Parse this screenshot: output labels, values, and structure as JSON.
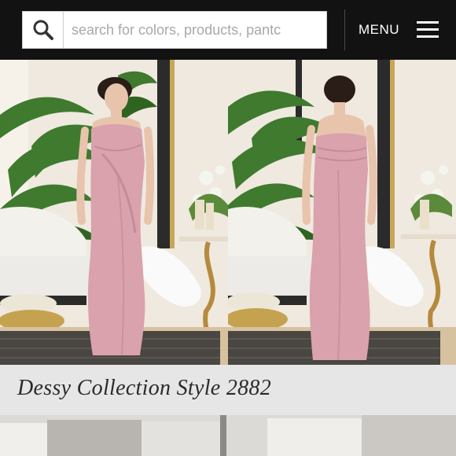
{
  "header": {
    "search": {
      "placeholder": "search for colors, products, pantc",
      "icon": "search-icon"
    },
    "menu_label": "MENU",
    "menu_icon": "hamburger-menu-icon"
  },
  "product": {
    "title": "Dessy Collection Style 2882",
    "photo_alt": "Model wearing a blush pink strapless column gown, front and back views"
  },
  "colors": {
    "topbar": "#121212",
    "dress": "#d9a2ad",
    "title_bar": "#e6e6e6"
  }
}
